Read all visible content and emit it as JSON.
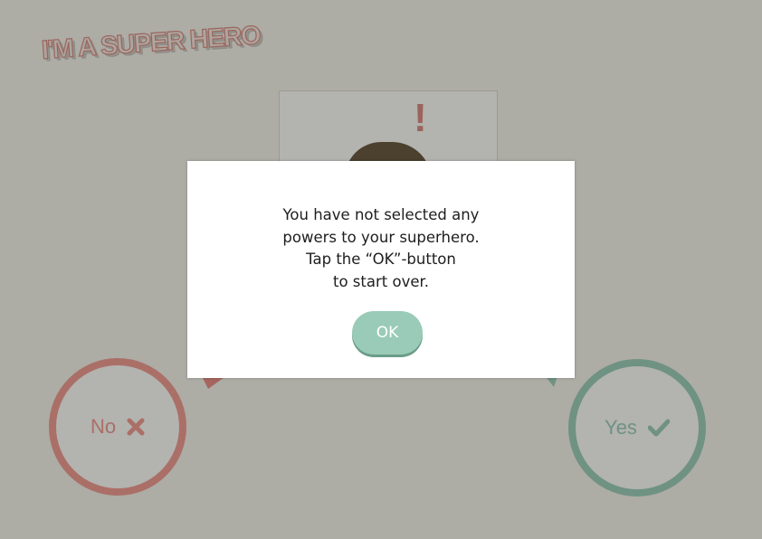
{
  "app": {
    "logo_text": "I'M A SUPER HERO"
  },
  "hero_card": {
    "mark": "!"
  },
  "choices": {
    "no_label": "No",
    "no_icon": "cross-icon",
    "yes_label": "Yes",
    "yes_icon": "checkmark-icon"
  },
  "dialog": {
    "message_lines": [
      "You have not selected any",
      "powers to your superhero.",
      "Tap the “OK”-button",
      "to start over."
    ],
    "ok_label": "OK"
  },
  "colors": {
    "no_red": "#f08a84",
    "yes_green": "#8ac7b3",
    "ok_green": "#9acbb8",
    "hair_brown": "#4f3a24"
  }
}
